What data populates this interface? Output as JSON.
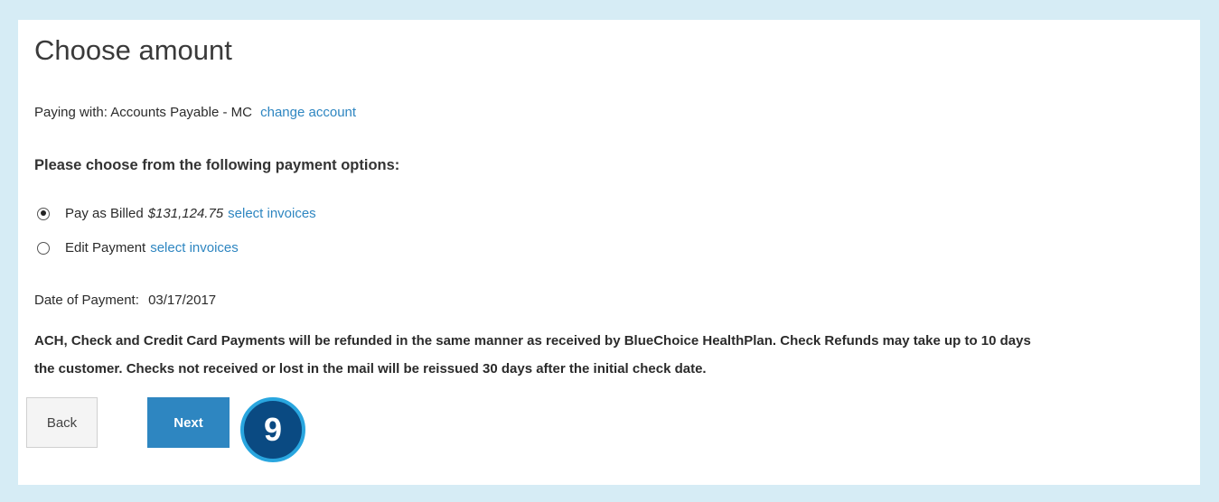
{
  "page": {
    "title": "Choose amount",
    "paying_with_label": "Paying with: Accounts Payable - MC",
    "change_account_link": "change account",
    "options_heading": "Please choose from the following payment options:",
    "options": [
      {
        "label": "Pay as Billed",
        "amount": "$131,124.75",
        "link": "select invoices",
        "selected": true
      },
      {
        "label": "Edit Payment",
        "link": "select invoices",
        "selected": false
      }
    ],
    "date_label": "Date of Payment:",
    "date_value": "03/17/2017",
    "notice_line1": "ACH, Check and Credit Card Payments will be refunded in the same manner as received by BlueChoice HealthPlan. Check Refunds may take up to 10 days",
    "notice_line2": "the customer. Checks not received or lost in the mail will be reissued 30 days after the initial check date."
  },
  "buttons": {
    "back_label": "Back",
    "next_label": "Next"
  },
  "step_badge": "9",
  "colors": {
    "accent": "#2e86c1",
    "badge_fill": "#0a4a82",
    "badge_ring": "#29a6df",
    "background": "#d6ecf5"
  }
}
